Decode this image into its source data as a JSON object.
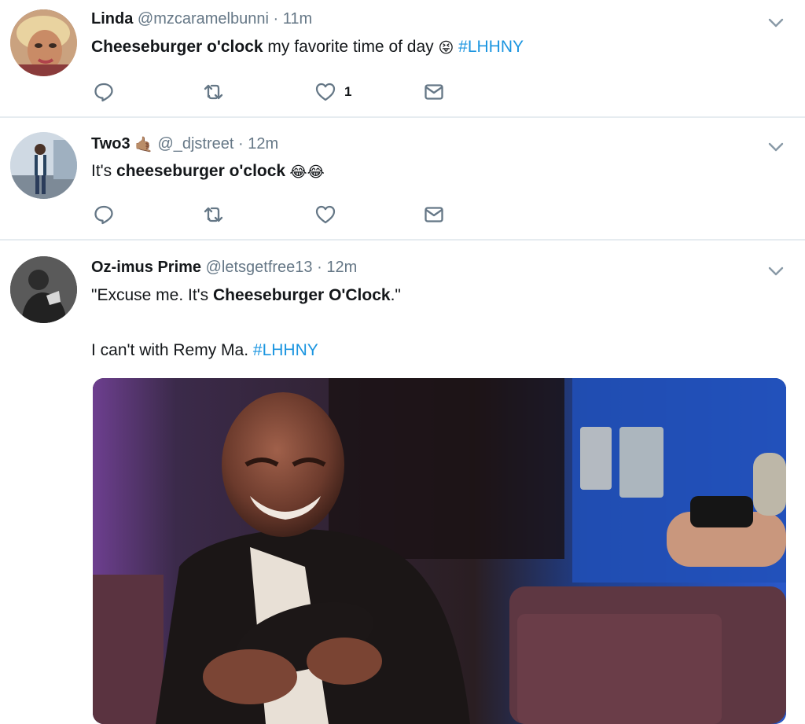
{
  "tweets": [
    {
      "name": "Linda",
      "handle": "@mzcaramelbunni",
      "dot": "·",
      "time": "11m",
      "text_bold": "Cheeseburger o'clock",
      "text_rest": " my favorite time of day ",
      "emoji": "😝",
      "hashtag": " #LHHNY",
      "like_count": "1"
    },
    {
      "name": "Two3",
      "name_emoji": "🤙🏽",
      "handle": "@_djstreet",
      "dot": "·",
      "time": "12m",
      "text_pre": "It's ",
      "text_bold": "cheeseburger o'clock",
      "emoji": " 😂😂"
    },
    {
      "name": "Oz-imus Prime",
      "handle": "@letsgetfree13",
      "dot": "·",
      "time": "12m",
      "line1_pre": "\"Excuse me. It's ",
      "line1_bold": "Cheeseburger O'Clock",
      "line1_post": ".\"",
      "line2_pre": "I can't with Remy Ma. ",
      "line2_hashtag": "#LHHNY"
    }
  ],
  "colors": {
    "accent": "#1b95e0",
    "icon": "#657786",
    "divider": "#e6ecf0"
  },
  "icons": [
    "reply-icon",
    "retweet-icon",
    "like-icon",
    "direct-message-icon",
    "chevron-down-icon"
  ]
}
